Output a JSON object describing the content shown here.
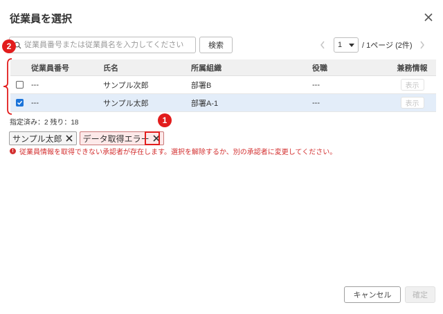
{
  "dialog": {
    "title": "従業員を選択"
  },
  "search": {
    "placeholder": "従業員番号または従業員名を入力してください",
    "button_label": "検索"
  },
  "pager": {
    "current_page": "1",
    "info": "/ 1ページ (2件)"
  },
  "table": {
    "headers": {
      "number": "従業員番号",
      "name": "氏名",
      "org": "所属組織",
      "role": "役職",
      "extra": "兼務情報"
    },
    "rows": [
      {
        "number": "---",
        "name": "サンプル次郎",
        "org": "部署B",
        "role": "---",
        "extra_button": "表示",
        "checked": false
      },
      {
        "number": "---",
        "name": "サンプル太郎",
        "org": "部署A-1",
        "role": "---",
        "extra_button": "表示",
        "checked": true
      }
    ]
  },
  "selection": {
    "counts": "指定済み：2 残り：18",
    "chips": [
      "サンプル太郎",
      "データ取得エラー"
    ],
    "error_message": "従業員情報を取得できない承認者が存在します。選択を解除するか、別の承認者に変更してください。"
  },
  "annotations": {
    "badge_1": "1",
    "badge_2": "2"
  },
  "footer": {
    "cancel_label": "キャンセル",
    "confirm_label": "確定"
  },
  "colors": {
    "accent": "#1a73d9",
    "annotation_red": "#e21c1c",
    "error_red": "#d32f2f",
    "selected_row": "#e3edf9"
  }
}
